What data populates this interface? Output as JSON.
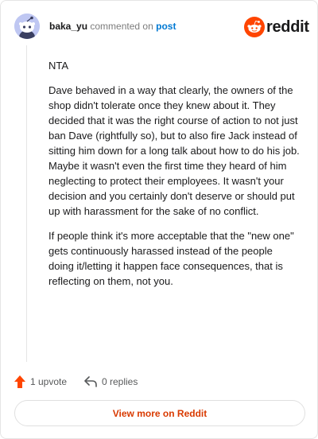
{
  "header": {
    "username": "baka_yu",
    "action_text": "commented on",
    "post_link": "post",
    "brand": "reddit"
  },
  "comment": {
    "paragraphs": [
      "NTA",
      "Dave behaved in a way that clearly, the owners of the shop didn't tolerate once they knew about it. They decided that it was the right course of action to not just ban Dave (rightfully so), but to also fire Jack instead of sitting him down for a long talk about how to do his job. Maybe it wasn't even the first time they heard of him neglecting to protect their employees. It wasn't your decision and you certainly don't deserve or should put up with harassment for the sake of no conflict.",
      "If people think it's more acceptable that the \"new one\" gets continuously harassed instead of the people doing it/letting it happen face consequences, that is reflecting on them, not you."
    ]
  },
  "footer": {
    "upvotes": "1 upvote",
    "replies": "0 replies",
    "view_more": "View more on Reddit"
  },
  "colors": {
    "accent": "#ff4500",
    "link": "#0079d3",
    "view_more_text": "#d93a00"
  }
}
